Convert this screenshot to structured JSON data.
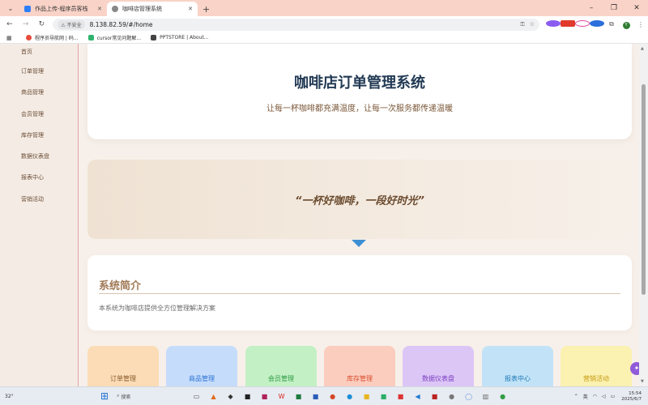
{
  "browser": {
    "tabs": [
      {
        "title": "作品上传-程序员客栈",
        "active": false,
        "favicon_color": "#2d7ff9"
      },
      {
        "title": "咖啡店管理系统",
        "active": true,
        "favicon_color": "#888888"
      }
    ],
    "new_tab_label": "+",
    "window_controls": {
      "minimize": "–",
      "restore": "❐",
      "close": "✕"
    },
    "address": {
      "security_label": "不安全",
      "url": "8.138.82.59/#/home"
    },
    "bookmarks": [
      {
        "label": "程序员导航网 | 码...",
        "color": "#e94b3c"
      },
      {
        "label": "cursor常见问题解...",
        "color": "#2fb36d"
      },
      {
        "label": "PPTSTORE | About...",
        "color": "#444444"
      }
    ],
    "profile_initial": "Y"
  },
  "sidebar": {
    "items": [
      {
        "label": "首页"
      },
      {
        "label": "订单管理"
      },
      {
        "label": "商品管理"
      },
      {
        "label": "会员管理"
      },
      {
        "label": "库存管理"
      },
      {
        "label": "数据仪表盘"
      },
      {
        "label": "报表中心"
      },
      {
        "label": "营销活动"
      }
    ]
  },
  "hero": {
    "title": "咖啡店订单管理系统",
    "subtitle": "让每一杯咖啡都充满温度，让每一次服务都传递温暖"
  },
  "quote": {
    "text": "“一杯好咖啡，一段好时光”"
  },
  "intro": {
    "heading": "系统简介",
    "body": "本系统为咖啡店提供全方位管理解决方案"
  },
  "cards": [
    {
      "label": "订单管理",
      "bg": "#fbdcb6",
      "color": "#8a5a2b"
    },
    {
      "label": "商品管理",
      "bg": "#c6dcfb",
      "color": "#2b74d4"
    },
    {
      "label": "会员管理",
      "bg": "#c3f0c4",
      "color": "#2c9a45"
    },
    {
      "label": "库存管理",
      "bg": "#fbcdbf",
      "color": "#d8502e"
    },
    {
      "label": "数据仪表盘",
      "bg": "#dcc6f6",
      "color": "#7a3fc2"
    },
    {
      "label": "报表中心",
      "bg": "#c2e3f7",
      "color": "#1f7ab8"
    },
    {
      "label": "营销活动",
      "bg": "#fbf1b0",
      "color": "#c79a12"
    }
  ],
  "taskbar": {
    "weather": "32°",
    "search_label": "搜索",
    "ime": "英",
    "time": "15:54",
    "date": "2025/6/7"
  }
}
